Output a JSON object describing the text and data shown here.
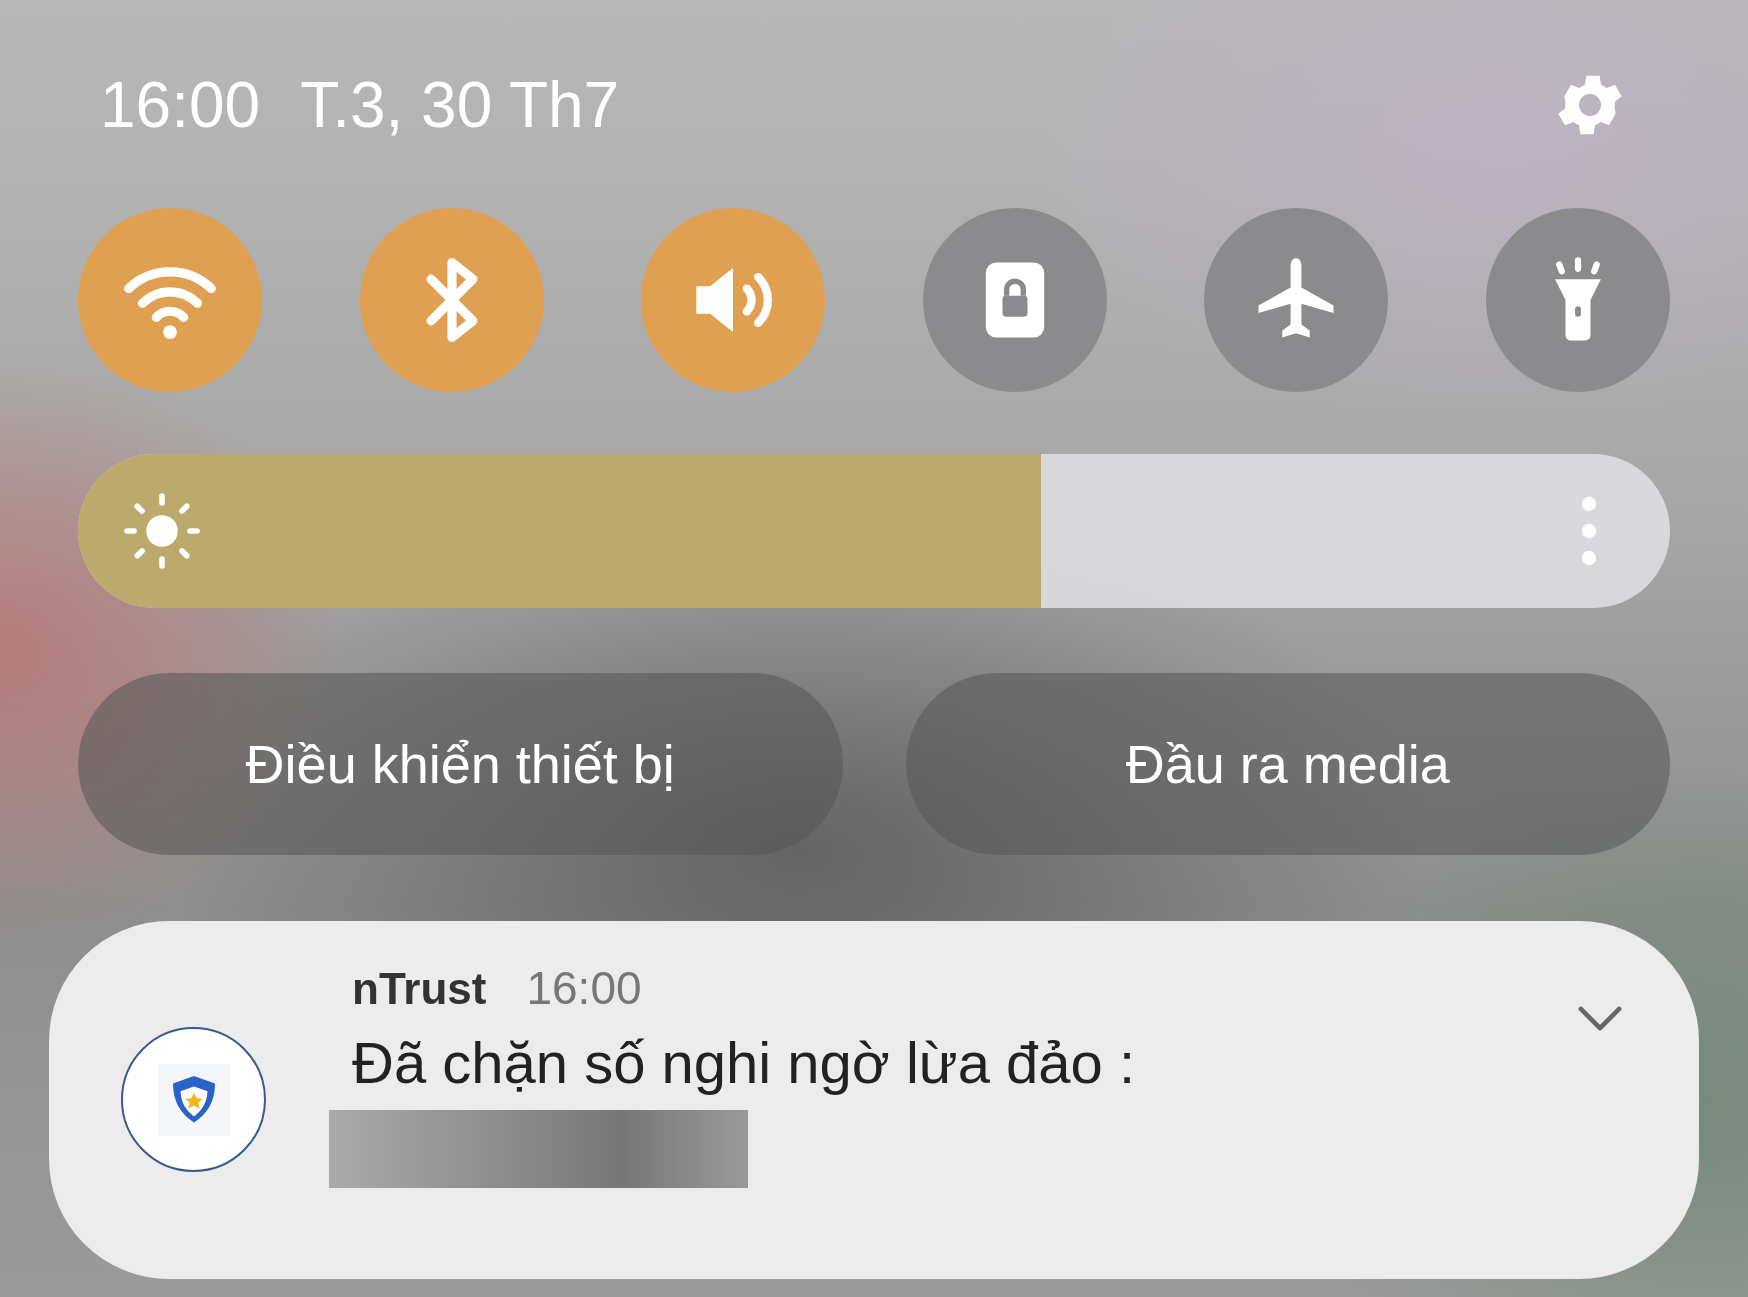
{
  "header": {
    "time": "16:00",
    "date": "T.3, 30 Th7"
  },
  "toggles": [
    {
      "kind": "wifi",
      "on": true
    },
    {
      "kind": "bluetooth",
      "on": true
    },
    {
      "kind": "sound",
      "on": true
    },
    {
      "kind": "rotation-lock",
      "on": false
    },
    {
      "kind": "airplane",
      "on": false
    },
    {
      "kind": "flashlight",
      "on": false
    }
  ],
  "brightness": {
    "level": 0.605
  },
  "buttons": [
    "Điều khiển thiết bị",
    "Đầu ra media"
  ],
  "notification": {
    "app": "nTrust",
    "time": "16:00",
    "message": "Đã chặn số nghi ngờ lừa đảo :"
  }
}
